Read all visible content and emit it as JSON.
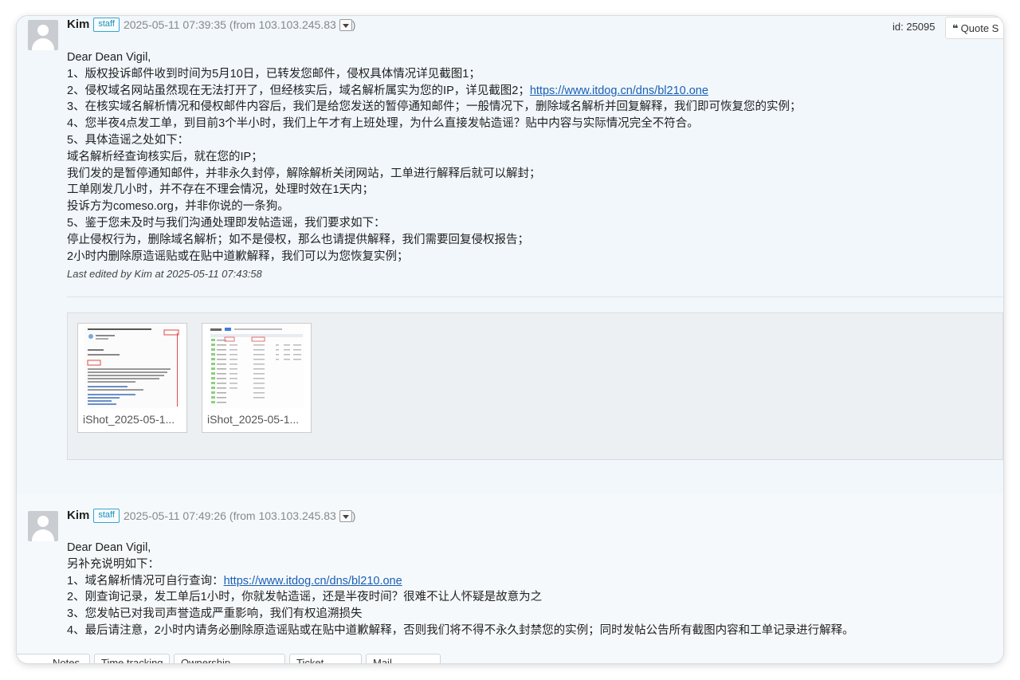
{
  "posts": [
    {
      "author": "Kim",
      "badge": "staff",
      "timestamp": "2025-05-11 07:39:35",
      "from_text": "(from 103.103.245.83",
      "close_paren": ")",
      "id_label": "id: 25095",
      "quote_label": "Quote S",
      "lines": [
        "Dear Dean Vigil,",
        "1、版权投诉邮件收到时间为5月10日，已转发您邮件，侵权具体情况详见截图1；",
        "2、侵权域名网站虽然现在无法打开了，但经核实后，域名解析属实为您的IP，详见截图2；",
        "3、在核实域名解析情况和侵权邮件内容后，我们是给您发送的暂停通知邮件；一般情况下，删除域名解析并回复解释，我们即可恢复您的实例；",
        "4、您半夜4点发工单，到目前3个半小时，我们上午才有上班处理，为什么直接发帖造谣？贴中内容与实际情况完全不符合。",
        "5、具体造谣之处如下：",
        "域名解析经查询核实后，就在您的IP；",
        "我们发的是暂停通知邮件，并非永久封停，解除解析关闭网站，工单进行解释后就可以解封；",
        "工单刚发几小时，并不存在不理会情况，处理时效在1天内；",
        "投诉方为comeso.org，并非你说的一条狗。",
        "5、鉴于您未及时与我们沟通处理即发帖造谣，我们要求如下：",
        "停止侵权行为，删除域名解析；如不是侵权，那么也请提供解释，我们需要回复侵权报告；",
        "2小时内删除原造谣贴或在贴中道歉解释，我们可以为您恢复实例；"
      ],
      "link": "https://www.itdog.cn/dns/bl210.one",
      "last_edited": "Last edited by Kim at 2025-05-11 07:43:58",
      "attachments": [
        {
          "name": "iShot_2025-05-1..."
        },
        {
          "name": "iShot_2025-05-1..."
        }
      ]
    },
    {
      "author": "Kim",
      "badge": "staff",
      "timestamp": "2025-05-11 07:49:26",
      "from_text": "(from 103.103.245.83",
      "close_paren": ")",
      "lines": [
        "Dear Dean Vigil,",
        "另补充说明如下：",
        "1、域名解析情况可自行查询：",
        "2、刚查询记录，发工单后1小时，你就发帖造谣，还是半夜时间？很难不让人怀疑是故意为之",
        "3、您发帖已对我司声誉造成严重影响，我们有权追溯损失",
        "4、最后请注意，2小时内请务必删除原造谣贴或在贴中道歉解释，否则我们将不得不永久封禁您的实例；同时发帖公告所有截图内容和工单记录进行解释。"
      ],
      "link": "https://www.itdog.cn/dns/bl210.one"
    }
  ],
  "bottom_tabs": [
    "Notes",
    "Time tracking",
    "Ownership",
    "Ticket",
    "Mail"
  ],
  "colors": {
    "accent_link": "#1a5fb4",
    "staff_badge": "#1b8fb6",
    "post_bg": "#f1f7fb"
  },
  "icons": {
    "quote": "quote-icon",
    "dropdown": "caret-down-icon",
    "avatar": "user-avatar-icon"
  }
}
